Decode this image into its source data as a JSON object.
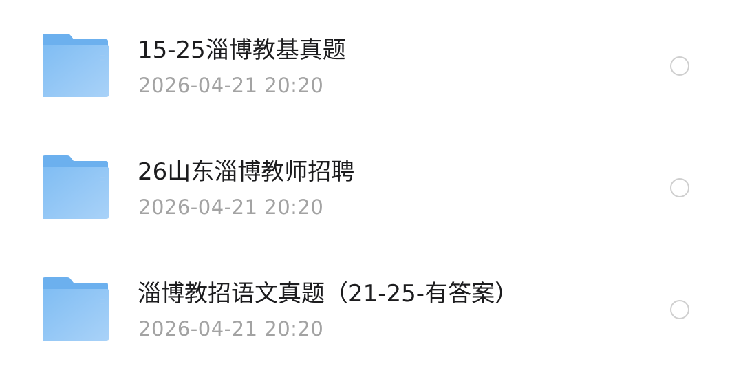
{
  "files": [
    {
      "icon": "folder-icon",
      "name": "15-25淄博教基真题",
      "date": "2026-04-21 20:20",
      "selected": false
    },
    {
      "icon": "folder-icon",
      "name": "26山东淄博教师招聘",
      "date": "2026-04-21 20:20",
      "selected": false
    },
    {
      "icon": "folder-icon",
      "name": "淄博教招语文真题（21-25-有答案）",
      "date": "2026-04-21 20:20",
      "selected": false
    }
  ],
  "colors": {
    "folder_front": "#7fbdf3",
    "folder_back": "#6fb2ef",
    "name_text": "#1c1c1e",
    "date_text": "#a3a3a3",
    "radio_border": "#cfcfcf"
  }
}
